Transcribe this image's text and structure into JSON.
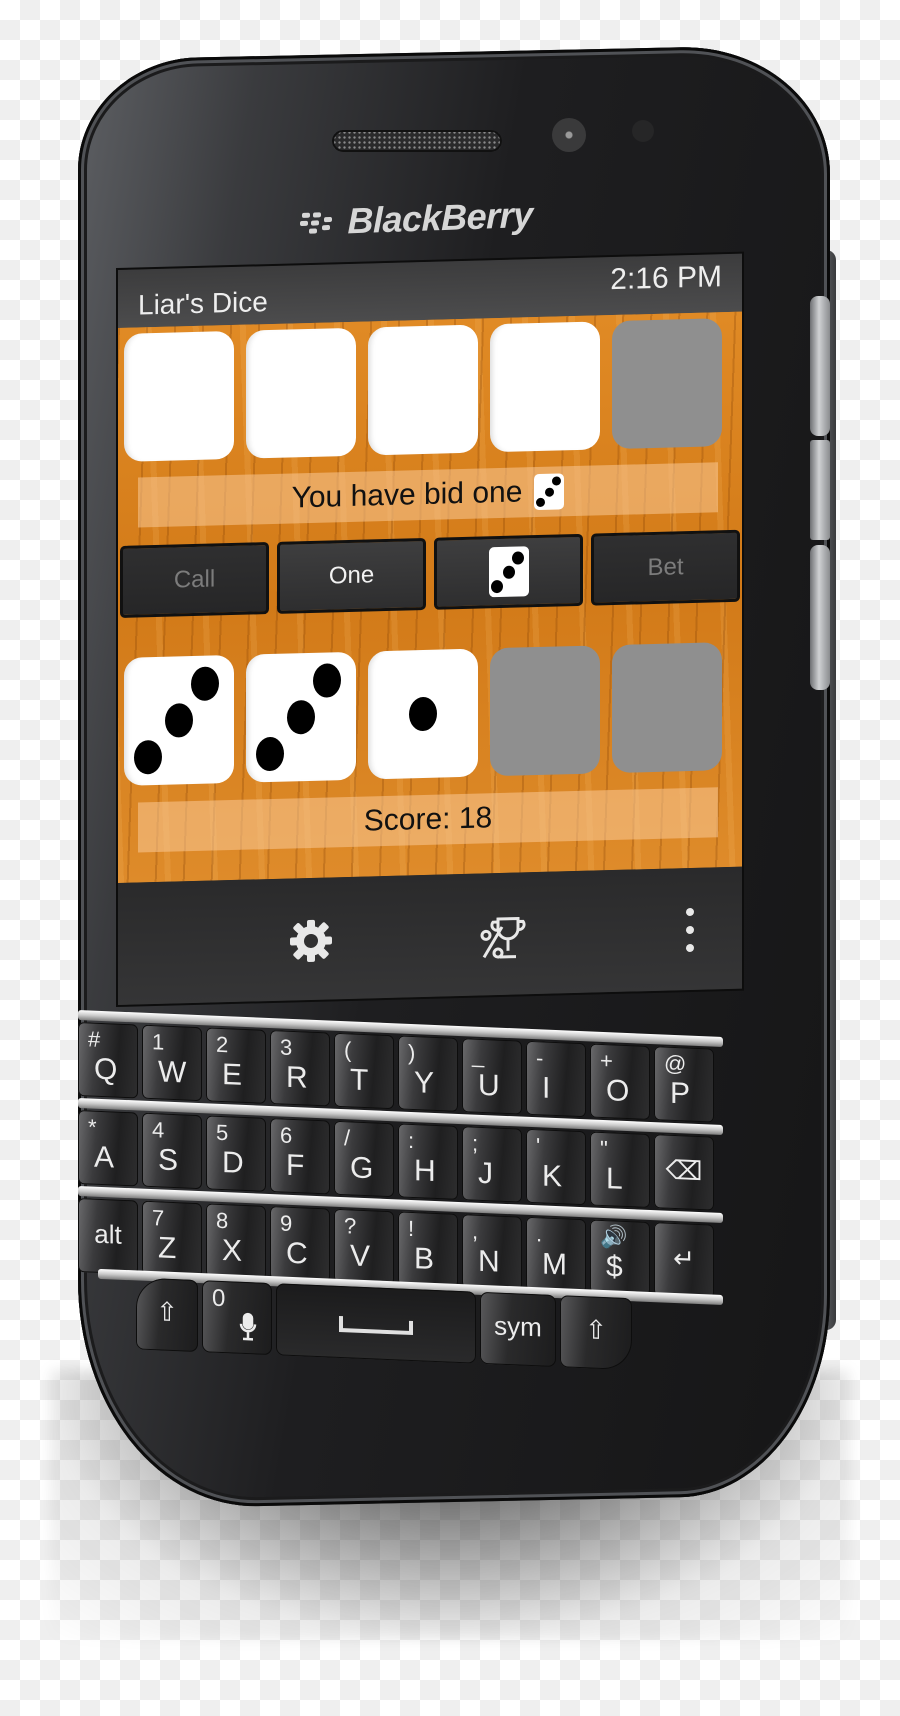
{
  "device": {
    "brand": "BlackBerry"
  },
  "app": {
    "title": "Liar's Dice",
    "clock": "2:16 PM"
  },
  "game": {
    "opponent_dice": [
      {
        "state": "face-down-white",
        "value": null
      },
      {
        "state": "face-down-white",
        "value": null
      },
      {
        "state": "face-down-white",
        "value": null
      },
      {
        "state": "face-down-white",
        "value": null
      },
      {
        "state": "empty-grey",
        "value": null
      }
    ],
    "bid_message": "You have bid one",
    "bid_die_value": 3,
    "controls": {
      "call_label": "Call",
      "call_enabled": false,
      "quantity_label": "One",
      "face_die_value": 3,
      "bet_label": "Bet",
      "bet_enabled": false
    },
    "player_dice": [
      {
        "state": "shown",
        "value": 3
      },
      {
        "state": "shown",
        "value": 3
      },
      {
        "state": "shown",
        "value": 1
      },
      {
        "state": "empty-grey",
        "value": null
      },
      {
        "state": "empty-grey",
        "value": null
      }
    ],
    "score_text": "Score: 18",
    "score": 18
  },
  "action_bar": {
    "items": [
      {
        "icon": "gear-icon",
        "name": "settings"
      },
      {
        "icon": "trophy-percent-icon",
        "name": "statistics"
      },
      {
        "icon": "overflow-menu-icon",
        "name": "more"
      }
    ]
  },
  "keyboard": {
    "rows": [
      [
        {
          "alt": "#",
          "main": "Q"
        },
        {
          "alt": "1",
          "main": "W"
        },
        {
          "alt": "2",
          "main": "E"
        },
        {
          "alt": "3",
          "main": "R"
        },
        {
          "alt": "(",
          "main": "T"
        },
        {
          "alt": ")",
          "main": "Y"
        },
        {
          "alt": "_",
          "main": "U"
        },
        {
          "alt": "-",
          "main": "I"
        },
        {
          "alt": "+",
          "main": "O"
        },
        {
          "alt": "@",
          "main": "P"
        }
      ],
      [
        {
          "alt": "*",
          "main": "A"
        },
        {
          "alt": "4",
          "main": "S"
        },
        {
          "alt": "5",
          "main": "D"
        },
        {
          "alt": "6",
          "main": "F"
        },
        {
          "alt": "/",
          "main": "G"
        },
        {
          "alt": ":",
          "main": "H"
        },
        {
          "alt": ";",
          "main": "J"
        },
        {
          "alt": "'",
          "main": "K"
        },
        {
          "alt": "\"",
          "main": "L"
        },
        {
          "alt": "",
          "main": "⌫",
          "name": "backspace"
        }
      ],
      [
        {
          "alt": "",
          "main": "alt",
          "name": "alt"
        },
        {
          "alt": "7",
          "main": "Z"
        },
        {
          "alt": "8",
          "main": "X"
        },
        {
          "alt": "9",
          "main": "C"
        },
        {
          "alt": "?",
          "main": "V"
        },
        {
          "alt": "!",
          "main": "B"
        },
        {
          "alt": ",",
          "main": "N"
        },
        {
          "alt": ".",
          "main": "M"
        },
        {
          "alt": "🔊",
          "main": "$"
        },
        {
          "alt": "",
          "main": "↵",
          "name": "enter"
        }
      ]
    ],
    "bottom": {
      "shift_left": "⇧",
      "zero_label": "0",
      "mic": "🎤",
      "space": "␣",
      "sym_label": "sym",
      "shift_right": "⇧"
    }
  }
}
